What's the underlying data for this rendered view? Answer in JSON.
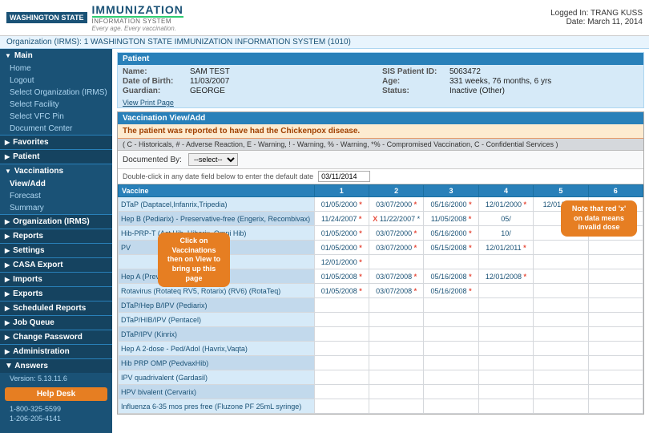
{
  "header": {
    "logged_in_label": "Logged In:",
    "user_name": "TRANG KUSS",
    "date_label": "Date:",
    "date_value": "March 11, 2014",
    "org_label": "Organization (IRMS):",
    "org_value": "1 WASHINGTON STATE IMMUNIZATION INFORMATION SYSTEM (1010)",
    "logo_state": "WASHINGTON STATE",
    "logo_title": "IMMUNIZATION",
    "logo_subtitle": "INFORMATION SYSTEM",
    "logo_tagline": "Every age. Every vaccination."
  },
  "patient": {
    "section_title": "Patient",
    "name_label": "Name:",
    "name_value": "SAM TEST",
    "patient_id_label": "SIS Patient ID:",
    "patient_id_value": "5063472",
    "dob_label": "Date of Birth:",
    "dob_value": "11/03/2007",
    "age_label": "Age:",
    "age_value": "331 weeks, 76 months, 6 yrs",
    "guardian_label": "Guardian:",
    "guardian_value": "GEORGE",
    "status_label": "Status:",
    "status_value": "Inactive (Other)",
    "view_print": "View Print Page"
  },
  "vaccination": {
    "section_title": "Vaccination View/Add",
    "chickenpox_warning": "The patient was reported to have had the Chickenpox disease.",
    "legend": "( C - Historicals, # - Adverse Reaction, E - Warning, ! - Warning, % - Warning, *% - Compromised Vaccination, C - Confidential Services )",
    "documented_by_label": "Documented By:",
    "documented_by_value": "--select--",
    "date_hint": "Double-click in any date field below to enter the default date",
    "default_date": "03/11/2014",
    "columns": [
      "Vaccine",
      "1",
      "2",
      "3",
      "4",
      "5",
      "6"
    ],
    "vaccines": [
      {
        "name": "DTaP (Daptacel,Infanrix,Tripedia)",
        "dates": [
          "01/05/2000 *",
          "03/07/2000 *",
          "05/16/2000 *",
          "12/01/2000 *",
          "12/01/2011",
          ""
        ]
      },
      {
        "name": "Hep B (Pediarix) - Preservative-free (Engerix, Recombivax)",
        "dates": [
          "11/24/2007 *",
          "X 11/22/2007 *",
          "11/05/2008 *",
          "05/",
          "",
          ""
        ]
      },
      {
        "name": "Hib-PRP-T (Act Hib, Hiberix, Omni Hib)",
        "dates": [
          "01/05/2000 *",
          "03/07/2000 *",
          "05/16/2000 *",
          "10/",
          "",
          ""
        ]
      },
      {
        "name": "PV",
        "dates": [
          "01/05/2000 *",
          "03/07/2000 *",
          "05/15/2008 *",
          "12/01/2011 *",
          "",
          ""
        ]
      },
      {
        "name": "",
        "dates": [
          "12/01/2000 *",
          "",
          "",
          "",
          "",
          ""
        ]
      },
      {
        "name": "Hep A (Prevnar13)",
        "dates": [
          "01/05/2008 *",
          "03/07/2008 *",
          "05/16/2008 *",
          "12/01/2008 *",
          "",
          ""
        ]
      },
      {
        "name": "Rotavirus (Rotateq RV5, Rotarix) (RV6) (RotaTeq)",
        "dates": [
          "01/05/2008 *",
          "03/07/2008 *",
          "05/16/2008 *",
          "",
          "",
          ""
        ]
      },
      {
        "name": "DTaP/Hep B/IPV (Pediarix)",
        "dates": [
          "",
          "",
          "",
          "",
          "",
          ""
        ]
      },
      {
        "name": "DTaP/HIB/IPV (Pentacel)",
        "dates": [
          "",
          "",
          "",
          "",
          "",
          ""
        ]
      },
      {
        "name": "DTaP/IPV (Kinrix)",
        "dates": [
          "",
          "",
          "",
          "",
          "",
          ""
        ]
      },
      {
        "name": "Hep A 2-dose - Ped/Adol (Havrix,Vaqta)",
        "dates": [
          "",
          "",
          "",
          "",
          "",
          ""
        ]
      },
      {
        "name": "Hib PRP OMP (PedvaxHib)",
        "dates": [
          "",
          "",
          "",
          "",
          "",
          ""
        ]
      },
      {
        "name": "IPV quadrivalent (Gardasil)",
        "dates": [
          "",
          "",
          "",
          "",
          "",
          ""
        ]
      },
      {
        "name": "HPV bivalent (Cervarix)",
        "dates": [
          "",
          "",
          "",
          "",
          "",
          ""
        ]
      },
      {
        "name": "Influenza 6-35 mos pres free (Fluzone PF 25mL syringe)",
        "dates": [
          "",
          "",
          "",
          "",
          "",
          ""
        ]
      }
    ],
    "callout1": "Click on Vaccinations then on View to bring up this page",
    "callout2": "Note that red 'x' on data means invalid dose"
  },
  "sidebar": {
    "sections": [
      {
        "label": "Main",
        "expanded": true,
        "items": [
          "Home",
          "Logout",
          "Select Organization (IRMS)",
          "Select Facility",
          "Select VFC Pin",
          "Document Center"
        ]
      },
      {
        "label": "Favorites",
        "expanded": false,
        "items": []
      },
      {
        "label": "Patient",
        "expanded": false,
        "items": []
      },
      {
        "label": "Vaccinations",
        "expanded": true,
        "items": [
          "View/Add",
          "Forecast",
          "Summary"
        ]
      },
      {
        "label": "Organization (IRMS)",
        "expanded": false,
        "items": []
      },
      {
        "label": "Reports",
        "expanded": false,
        "items": []
      },
      {
        "label": "Settings",
        "expanded": false,
        "items": []
      },
      {
        "label": "CASA Export",
        "expanded": false,
        "items": []
      },
      {
        "label": "Imports",
        "expanded": false,
        "items": []
      },
      {
        "label": "Exports",
        "expanded": false,
        "items": []
      },
      {
        "label": "Scheduled Reports",
        "expanded": false,
        "items": []
      },
      {
        "label": "Job Queue",
        "expanded": false,
        "items": []
      },
      {
        "label": "Change Password",
        "expanded": false,
        "items": []
      },
      {
        "label": "Administration",
        "expanded": false,
        "items": []
      }
    ],
    "answers_label": "Answers",
    "version": "Version: 5.13.11.6",
    "help_desk": "Help Desk",
    "phone1": "1-800-325-5599",
    "phone2": "1-206-205-4141"
  }
}
